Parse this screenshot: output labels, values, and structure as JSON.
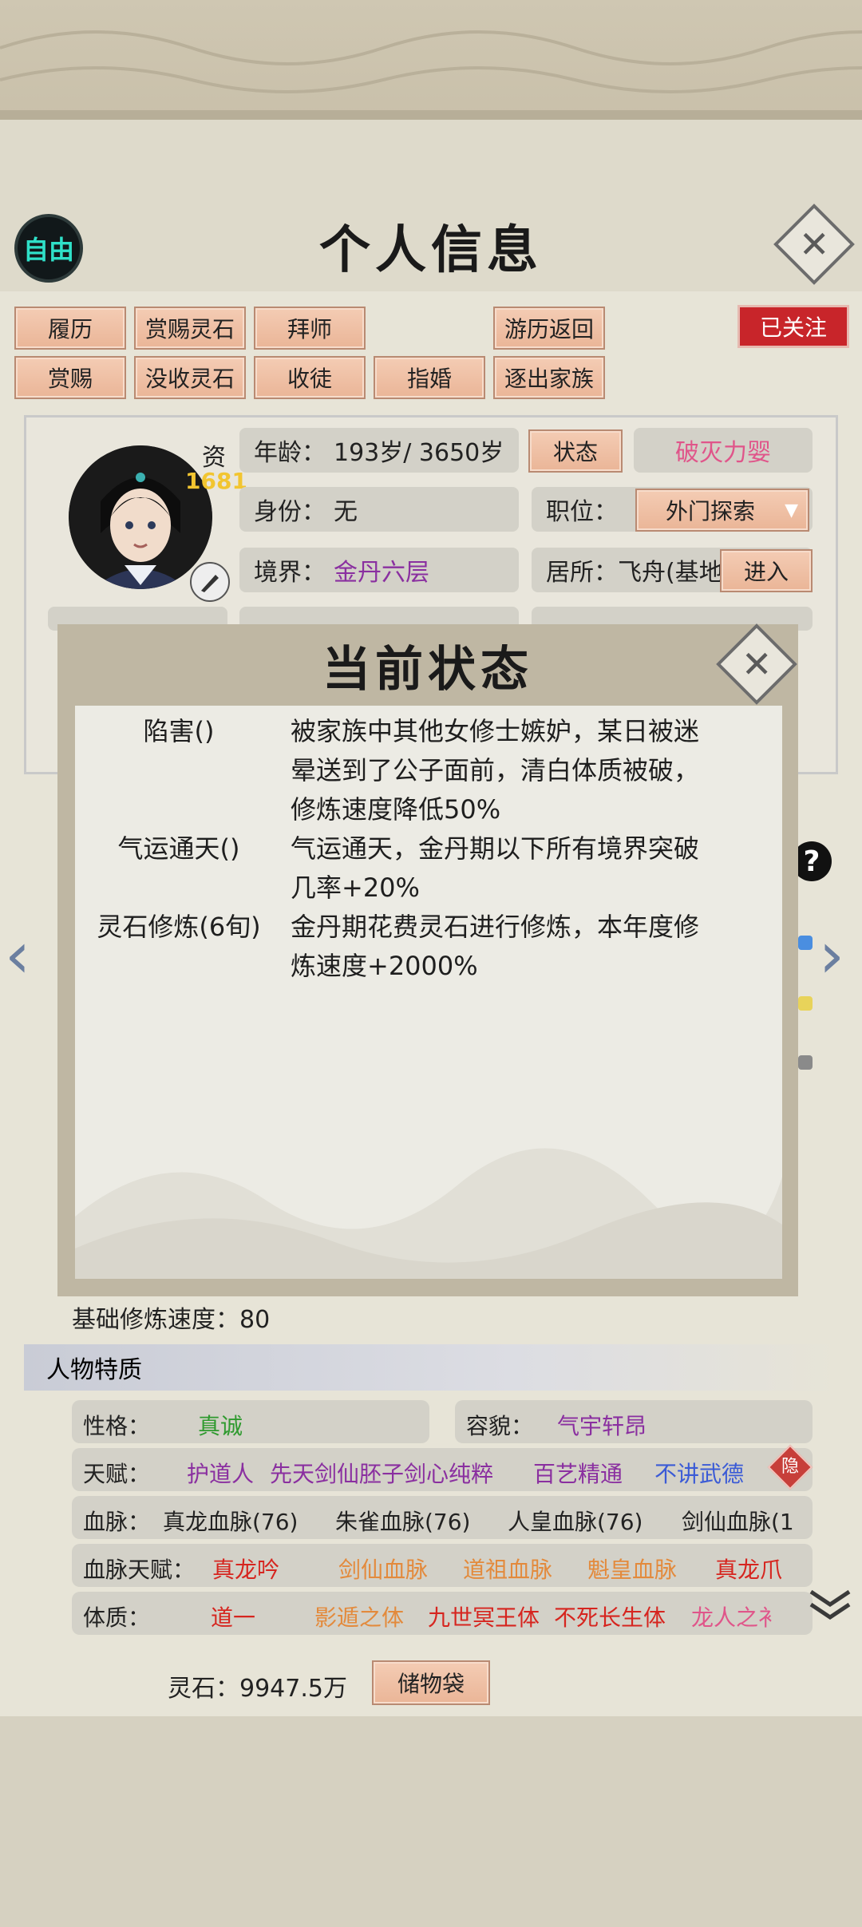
{
  "header": {
    "mode_badge": "自由",
    "title": "个人信息",
    "close_glyph": "✕"
  },
  "actions": {
    "row1": [
      "履历",
      "赏赐灵石",
      "拜师",
      "游历返回"
    ],
    "row2": [
      "赏赐",
      "没收灵石",
      "收徒",
      "指婚",
      "逐出家族"
    ],
    "followed": "已关注"
  },
  "profile": {
    "zi_label": "资",
    "zi_value": "1681",
    "age_label": "年龄：",
    "age_value": "193岁/ 3650岁",
    "status_button": "状态",
    "breakthrough": "破灭力婴",
    "identity_label": "身份：",
    "identity_value": "无",
    "position_label": "职位：",
    "position_value": "外门探索",
    "realm_label": "境界：",
    "realm_value": "金丹六层",
    "residence_label": "居所：",
    "residence_value": "飞舟(基地",
    "enter_button": "进入"
  },
  "dialog": {
    "title": "当前状态",
    "close_glyph": "✕",
    "statuses": [
      {
        "name": "陷害()",
        "lines": [
          "被家族中其他女修士嫉妒，某日被迷",
          "晕送到了公子面前，清白体质被破，",
          "修炼速度降低50%"
        ]
      },
      {
        "name": "气运通天()",
        "lines": [
          "气运通天，金丹期以下所有境界突破",
          "几率+20%"
        ]
      },
      {
        "name": "灵石修炼(6旬)",
        "lines": [
          "金丹期花费灵石进行修炼，本年度修",
          "炼速度+2000%"
        ]
      }
    ]
  },
  "nav": {
    "left_arrow": "‹",
    "right_arrow": "›",
    "help": "?"
  },
  "base_speed": "基础修炼速度：80",
  "traits": {
    "section_title": "人物特质",
    "personality_label": "性格：",
    "personality_value": "真诚",
    "looks_label": "容貌：",
    "looks_value": "气宇轩昂",
    "talent_label": "天赋：",
    "talents": [
      "护道人",
      "先天剑仙胚子",
      "剑心纯粹",
      "百艺精通",
      "不讲武德"
    ],
    "hide_badge": "隐",
    "bloodline_label": "血脉：",
    "bloodlines": [
      "真龙血脉(76)",
      "朱雀血脉(76)",
      "人皇血脉(76)",
      "剑仙血脉(1"
    ],
    "bloodline_talent_label": "血脉天赋：",
    "bloodline_talents": [
      "真龙吟",
      "剑仙血脉",
      "道祖血脉",
      "魁皇血脉",
      "真龙爪"
    ],
    "physique_label": "体质：",
    "physiques": [
      "道一",
      "影遁之体",
      "九世冥王体",
      "不死长生体",
      "龙人之衤"
    ]
  },
  "footer": {
    "spirit_stone": "灵石：9947.5万",
    "bag_button": "储物袋"
  },
  "colors": {
    "accent_red": "#c8252a",
    "purple": "#8a2fa0",
    "green": "#2f9a2f",
    "blue": "#3b5bd6",
    "orange": "#e38a3c",
    "red": "#d6251f"
  }
}
